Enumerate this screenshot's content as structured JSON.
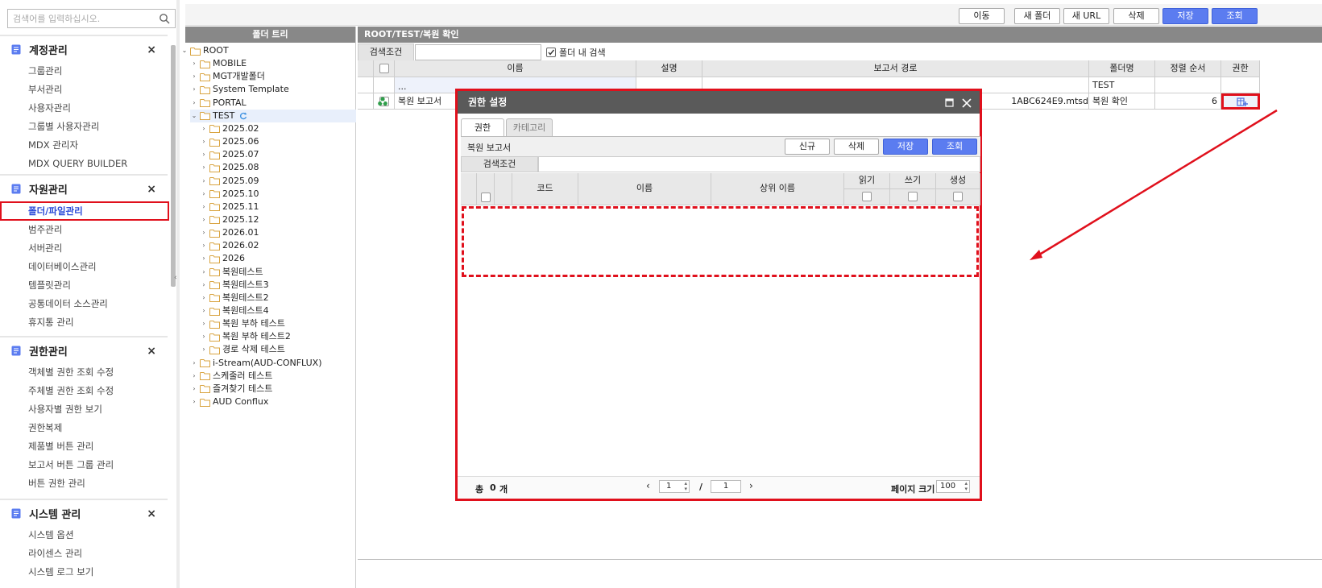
{
  "search": {
    "placeholder": "검색어를 입력하십시오."
  },
  "sidebar": {
    "groups": [
      {
        "title": "계정관리",
        "items": [
          "그룹관리",
          "부서관리",
          "사용자관리",
          "그룹별 사용자관리",
          "MDX 관리자",
          "MDX QUERY BUILDER"
        ]
      },
      {
        "title": "자원관리",
        "items": [
          "폴더/파일관리",
          "범주관리",
          "서버관리",
          "데이터베이스관리",
          "템플릿관리",
          "공통데이터 소스관리",
          "휴지통 관리"
        ]
      },
      {
        "title": "권한관리",
        "items": [
          "객체별 권한 조회 수정",
          "주체별 권한 조회 수정",
          "사용자별 권한 보기",
          "권한복제",
          "제품별 버튼 관리",
          "보고서 버튼 그룹 관리",
          "버튼 권한 관리"
        ]
      },
      {
        "title": "시스템 관리",
        "items": [
          "시스템 옵션",
          "라이센스 관리",
          "시스템 로그 보기"
        ]
      }
    ],
    "close_glyph": "×"
  },
  "toolbar": {
    "move": "이동",
    "new_folder": "새 폴더",
    "new_url": "새 URL",
    "delete": "삭제",
    "save": "저장",
    "search": "조회"
  },
  "tree": {
    "header": "폴더 트리",
    "root": "ROOT",
    "top": [
      "MOBILE",
      "MGT개발폴더",
      "System Template",
      "PORTAL"
    ],
    "test": "TEST",
    "test_children": [
      "2025.02",
      "2025.06",
      "2025.07",
      "2025.08",
      "2025.09",
      "2025.10",
      "2025.11",
      "2025.12",
      "2026.01",
      "2026.02",
      "2026",
      "복원테스트",
      "복원테스트3",
      "복원테스트2",
      "복원테스트4",
      "복원 부하 테스트",
      "복원 부하 테스트2",
      "경로 삭제 테스트"
    ],
    "bottom": [
      "i-Stream(AUD-CONFLUX)",
      "스케줄러 테스트",
      "즐겨찾기 테스트",
      "AUD Conflux"
    ]
  },
  "main": {
    "path": "ROOT/TEST/복원 확인",
    "cond_label": "검색조건",
    "in_folder": "폴더 내 검색",
    "columns": {
      "name": "이름",
      "desc": "설명",
      "path": "보고서 경로",
      "folder": "폴더명",
      "order": "정렬 순서",
      "perm": "권한"
    },
    "rows": [
      {
        "name": "...",
        "folder": "TEST"
      },
      {
        "name": "복원 보고서",
        "path": "1ABC624E9.mtsd",
        "folder": "복원 확인",
        "order": "6"
      }
    ]
  },
  "dialog": {
    "title": "권한 설정",
    "tabs": [
      "권한",
      "카테고리"
    ],
    "report_name": "복원 보고서",
    "buttons": {
      "new": "신규",
      "delete": "삭제",
      "save": "저장",
      "search": "조회"
    },
    "cond_label": "검색조건",
    "columns": {
      "code": "코드",
      "name": "이름",
      "parent": "상위 이름",
      "read": "읽기",
      "write": "쓰기",
      "create": "생성"
    },
    "footer": {
      "total_label": "총",
      "total": "0",
      "unit": "개",
      "page": "1",
      "sep": "/",
      "pages": "1",
      "size_label": "페이지 크기",
      "size": "100"
    }
  },
  "colors": {
    "accent": "#5b7cf0",
    "highlight": "#e0101c",
    "header_gray": "#888888"
  }
}
